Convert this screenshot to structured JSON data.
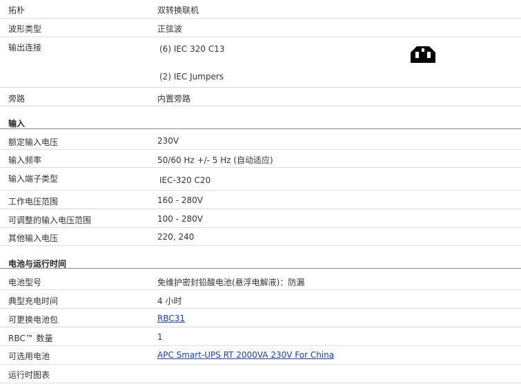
{
  "groups": [
    {
      "heading": "",
      "rows": [
        {
          "label": "拓朴",
          "value": "双转换联机"
        },
        {
          "label": "波形类型",
          "value": "正弦波"
        },
        {
          "label": "输出连接",
          "value": "(6) IEC 320 C13",
          "value2": "(2) IEC Jumpers"
        },
        {
          "label": "旁路",
          "value": "内置旁路"
        }
      ]
    },
    {
      "heading": "输入",
      "rows": [
        {
          "label": "额定输入电压",
          "value": "230V"
        },
        {
          "label": "输入频率",
          "value": "50/60 Hz +/- 5 Hz (自动适应)"
        },
        {
          "label": "输入端子类型",
          "value": "IEC-320 C20"
        },
        {
          "label": "工作电压范围",
          "value": "160 - 280V"
        },
        {
          "label": "可调整的输入电压范围",
          "value": "100 - 280V"
        },
        {
          "label": "其他输入电压",
          "value": "220, 240"
        }
      ]
    },
    {
      "heading": "电池与运行时间",
      "rows": [
        {
          "label": "电池型号",
          "value": "免维护密封铅酸电池(悬浮电解液)：防漏"
        },
        {
          "label": "典型充电时间",
          "value": "4 小时"
        },
        {
          "label": "可更换电池包",
          "value": "RBC31"
        },
        {
          "label": "RBC™ 数量",
          "value": "1"
        },
        {
          "label": "可选用电池",
          "value": "APC Smart-UPS RT 2000VA 230V For China"
        },
        {
          "label": "运行时图表",
          "value": ""
        }
      ]
    }
  ],
  "icons": {
    "outlet": "iec-c13-outlet-icon"
  },
  "colors": {
    "link": "#1a3ea8",
    "row_border": "#dddddd",
    "section_border": "#8a8a8a",
    "icon": "#000000"
  }
}
